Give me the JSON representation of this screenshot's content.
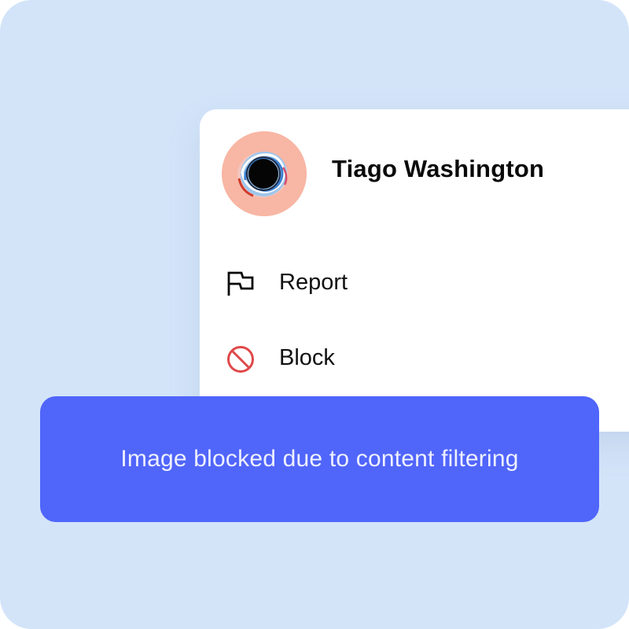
{
  "profile": {
    "name": "Tiago Washington",
    "avatar_icon": "swirl-avatar-icon"
  },
  "menu": {
    "items": [
      {
        "label": "Report",
        "icon": "flag-icon"
      },
      {
        "label": "Block",
        "icon": "block-icon"
      }
    ]
  },
  "overlay": {
    "message": "Image blocked due to content filtering"
  },
  "colors": {
    "backdrop": "#d3e4f9",
    "card": "#ffffff",
    "avatar_bg": "#f8b6a4",
    "block_icon": "#e0484a",
    "banner": "#5065fa",
    "banner_text": "#eef0ff"
  }
}
